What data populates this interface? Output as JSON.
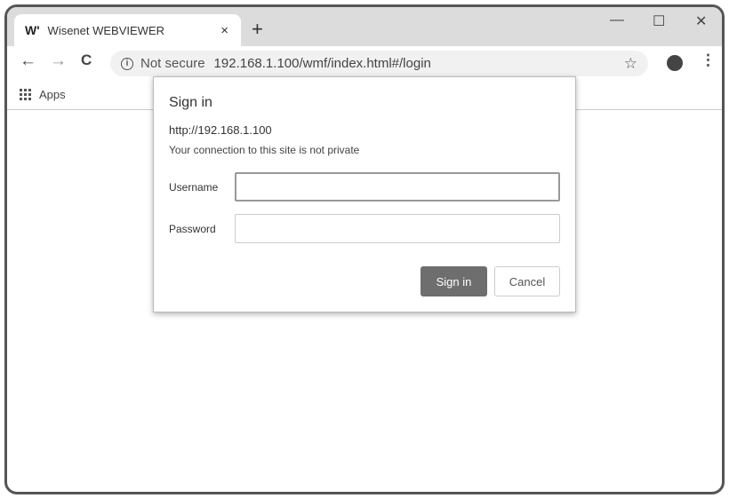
{
  "tab": {
    "logo": "W'",
    "title": "Wisenet WEBVIEWER",
    "close": "×",
    "new": "+"
  },
  "window": {
    "minimize": "—",
    "maximize": "☐",
    "close": "✕"
  },
  "toolbar": {
    "back": "←",
    "forward": "→",
    "reload": "C",
    "security": "Not secure",
    "url": "192.168.1.100/wmf/index.html#/login",
    "star": "☆",
    "menu": "⋮"
  },
  "bookmarks": {
    "apps": "Apps"
  },
  "dialog": {
    "title": "Sign in",
    "origin": "http://192.168.1.100",
    "warning": "Your connection to this site is not private",
    "username_label": "Username",
    "username_value": "",
    "password_label": "Password",
    "password_value": "",
    "signin": "Sign in",
    "cancel": "Cancel"
  }
}
